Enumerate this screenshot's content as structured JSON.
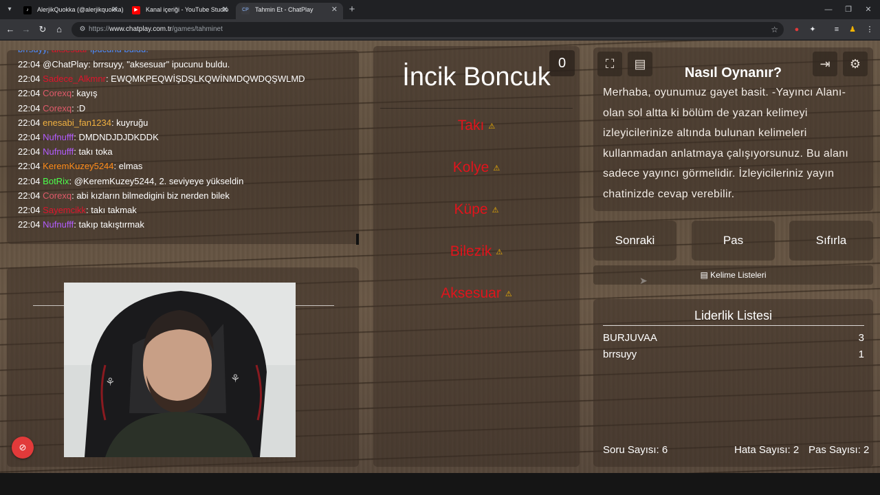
{
  "browser": {
    "tabs": [
      {
        "title": "AlerjikQuokka (@alerjikquokka)",
        "favicon": "tiktok-icon"
      },
      {
        "title": "Kanal içeriği - YouTube Studio",
        "favicon": "youtube-icon"
      },
      {
        "title": "Tahmin Et - ChatPlay",
        "favicon": "chatplay-icon"
      }
    ],
    "url_prefix": "https://",
    "url_domain": "www.chatplay.com.tr",
    "url_path": "/games/tahminet"
  },
  "chat": {
    "cut_user": "brrsuyy",
    "cut_text": "\"aksesuar\" ipucunu buldu.",
    "cut_middle": "aksesuar",
    "messages": [
      {
        "time": "22:04",
        "user": "@ChatPlay",
        "user_color": "#ffffff",
        "text": ": brrsuyy, \"aksesuar\" ipucunu buldu."
      },
      {
        "time": "22:04",
        "user": "Sadece_Alkmnr",
        "user_color": "#e0142c",
        "text": ": EWQMKPEQWİŞDŞLKQWİNMDQWDQŞWLMD"
      },
      {
        "time": "22:04",
        "user": "Corexq",
        "user_color": "#e05a6a",
        "text": ": kayış"
      },
      {
        "time": "22:04",
        "user": "Corexq",
        "user_color": "#e05a6a",
        "text": ": :D"
      },
      {
        "time": "22:04",
        "user": "enesabi_fan1234",
        "user_color": "#f0b040",
        "text": ": kuyruğu"
      },
      {
        "time": "22:04",
        "user": "Nufnufff",
        "user_color": "#b35cff",
        "text": ": DMDNDJDJDKDDK"
      },
      {
        "time": "22:04",
        "user": "Nufnufff",
        "user_color": "#b35cff",
        "text": ": takı toka"
      },
      {
        "time": "22:04",
        "user": "KeremKuzey5244",
        "user_color": "#ff8c1a",
        "text": ": elmas"
      },
      {
        "time": "22:04",
        "user": "BotRix",
        "user_color": "#4cff4c",
        "text": ": @KeremKuzey5244, 2. seviyeye yükseldin"
      },
      {
        "time": "22:04",
        "user": "Corexq",
        "user_color": "#e05a6a",
        "text": ": abi kızların bilmedigini biz nerden bilek"
      },
      {
        "time": "22:04",
        "user": "Sayemcikk",
        "user_color": "#e0142c",
        "text": ": takı takmak"
      },
      {
        "time": "22:04",
        "user": "Nufnufff",
        "user_color": "#b35cff",
        "text": ": takıp takıştırmak"
      }
    ]
  },
  "game": {
    "counter": "0",
    "word": "İncik Boncuk",
    "taboo_words": [
      "Takı",
      "Kolye",
      "Küpe",
      "Bilezik",
      "Aksesuar"
    ]
  },
  "how_to": {
    "title": "Nasıl Oynanır?",
    "text": "Merhaba, oyunumuz gayet basit. -Yayıncı Alanı- olan sol altta ki bölüm de yazan kelimeyi izleyicilerinize altında bulunan kelimeleri kullanmadan anlatmaya çalışıyorsunuz. Bu alanı sadece yayıncı görmelidir. İzleyicileriniz yayın chatinizde cevap verebilir."
  },
  "controls": {
    "next": "Sonraki",
    "pass": "Pas",
    "reset": "Sıfırla",
    "word_lists": "Kelime Listeleri"
  },
  "leaderboard": {
    "title": "Liderlik Listesi",
    "rows": [
      {
        "name": "BURJUVAA",
        "score": "3"
      },
      {
        "name": "brrsuyy",
        "score": "1"
      }
    ]
  },
  "stats": {
    "questions": "Soru Sayısı: 6",
    "errors": "Hata Sayısı: 2",
    "passes": "Pas Sayısı: 2"
  },
  "colors": {
    "taboo": "#e0141c",
    "warning": "#f4b400",
    "record": "#e23a3a"
  }
}
